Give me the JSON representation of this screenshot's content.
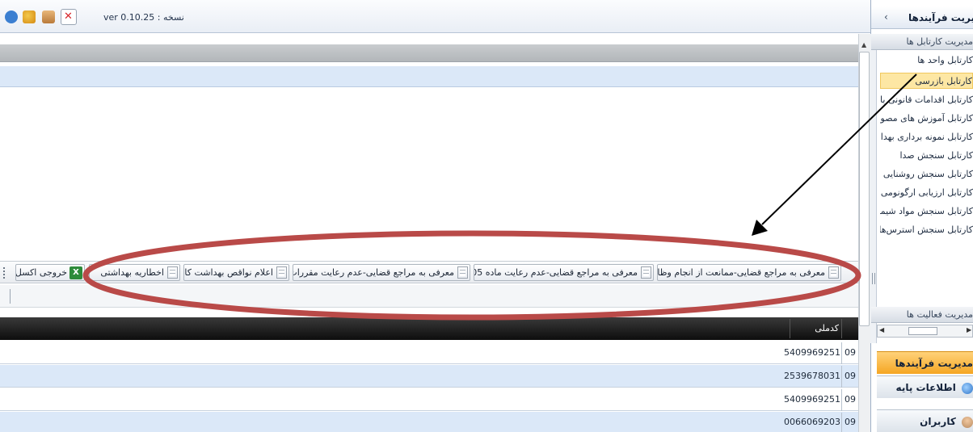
{
  "topbar": {
    "version_label": "ver 0.10.25 : نسخه",
    "icons": [
      "user-icon",
      "group-icon",
      "box-icon",
      "pdf-close-icon"
    ]
  },
  "toolbar": {
    "buttons": [
      {
        "label": "معرفی به مراجع قضایی-ممانعت از انجام وظایف",
        "icon": "document-icon"
      },
      {
        "label": "معرفی به مراجع قضایی-عدم رعایت ماده 105",
        "icon": "document-icon"
      },
      {
        "label": "معرفی به مراجع قضایی-عدم رعایت مقررات",
        "icon": "document-icon"
      },
      {
        "label": "اعلام نواقص بهداشت کار",
        "icon": "document-icon"
      },
      {
        "label": "اخطاریه بهداشتی",
        "icon": "document-icon"
      },
      {
        "label": "خروجی اکسل",
        "icon": "excel-icon"
      }
    ]
  },
  "grid": {
    "code_header": "کدملی",
    "rows": [
      {
        "code": "5409969251",
        "prefix": "09"
      },
      {
        "code": "2539678031",
        "prefix": "09"
      },
      {
        "code": "5409969251",
        "prefix": "09"
      },
      {
        "code": "0066069203",
        "prefix": "09"
      }
    ]
  },
  "sidebar": {
    "title": "مدیریت فرآیندها",
    "chevron": "‹",
    "group_cartables": "مدیریت کارتابل ها",
    "items": [
      {
        "label": "کارتابل واحد ها",
        "selected": false
      },
      {
        "label": "کارتابل بازرسی",
        "selected": true
      },
      {
        "label": "کارتابل اقدامات قانونی بازرسی",
        "selected": false
      },
      {
        "label": "کارتابل آموزش های مصوب",
        "selected": false
      },
      {
        "label": "کارتابل نمونه برداری بهداشتی",
        "selected": false
      },
      {
        "label": "کارتابل سنجش صدا",
        "selected": false
      },
      {
        "label": "کارتابل سنجش روشنایی",
        "selected": false
      },
      {
        "label": "کارتابل ارزیابی ارگونومی",
        "selected": false
      },
      {
        "label": "کارتابل سنجش مواد شیمیایی",
        "selected": false
      },
      {
        "label": "کارتابل  سنجش استرس‌های",
        "selected": false
      }
    ],
    "group_activities": "مدیریت فعالیت ها",
    "nav": [
      {
        "label": "مدیریت فرآیندها",
        "active": true,
        "icon": ""
      },
      {
        "label": "اطلاعات پایه",
        "active": false,
        "icon": "info-icon"
      },
      {
        "label": "کاربران",
        "active": false,
        "icon": "users-icon"
      }
    ]
  },
  "colors": {
    "accent_orange": "#f5a623",
    "annotation_ellipse": "#b94a48",
    "row_alt": "#dbe8f8",
    "header_dark": "#1a1a1a"
  }
}
